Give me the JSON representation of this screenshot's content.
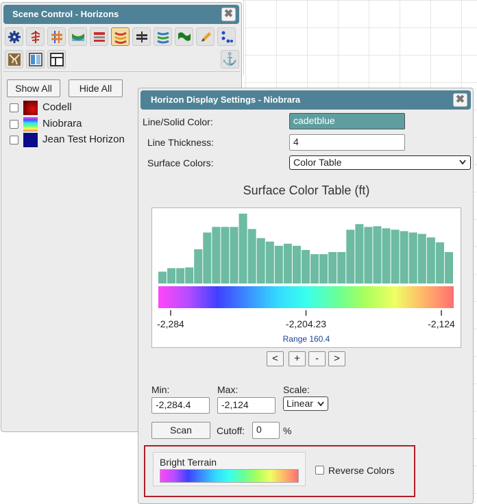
{
  "background": {
    "grid_color": "#e6e6e6"
  },
  "scene_control": {
    "title": "Scene Control - Horizons",
    "close_glyph": "✖",
    "toolbar_tools": [
      {
        "name": "settings-gear-icon",
        "color": "#1c3f8a"
      },
      {
        "name": "well-icon",
        "color": "#b3322b"
      },
      {
        "name": "faults-icon",
        "color": "#e07a2a"
      },
      {
        "name": "horizon-surface-icon",
        "color": "#3a8f2c"
      },
      {
        "name": "layers-red-icon",
        "color": "#c8302c"
      },
      {
        "name": "horizons-icon",
        "color": "#d03a2a",
        "active": true
      },
      {
        "name": "cross-section-icon",
        "color": "#333333"
      },
      {
        "name": "contours-icon",
        "color": "#2a7fc0"
      },
      {
        "name": "flag-green-icon",
        "color": "#1f7a1f"
      },
      {
        "name": "pencil-icon",
        "color": "#e8a020"
      },
      {
        "name": "points-icon",
        "color": "#1a4fd0"
      },
      {
        "name": "map-texture-icon",
        "color": "#8a6a3a"
      },
      {
        "name": "split-view-icon",
        "color": "#4a8fd0"
      },
      {
        "name": "layout-icon",
        "color": "#333333"
      }
    ],
    "anchor_icon": "⚓",
    "show_all_label": "Show All",
    "hide_all_label": "Hide All",
    "layers": [
      {
        "label": "Codell",
        "checked": false,
        "swatch": "codell"
      },
      {
        "label": "Niobrara",
        "checked": false,
        "swatch": "rainbow"
      },
      {
        "label": "Jean Test Horizon",
        "checked": false,
        "swatch": "navy"
      }
    ]
  },
  "horizon_dialog": {
    "title": "Horizon Display Settings - Niobrara",
    "close_glyph": "✖",
    "line_color_label": "Line/Solid Color:",
    "line_color_value": "cadetblue",
    "line_color_hex": "#5f9ea0",
    "line_thickness_label": "Line Thickness:",
    "line_thickness_value": "4",
    "surface_colors_label": "Surface Colors:",
    "surface_colors_value": "Color Table",
    "chart_title": "Surface Color Table (ft)",
    "range_label": "Range 160.4",
    "buttons": {
      "prev": "<",
      "plus": "+",
      "minus": "-",
      "next": ">"
    },
    "min_label": "Min:",
    "min_value": "-2,284.4",
    "max_label": "Max:",
    "max_value": "-2,124",
    "scale_label": "Scale:",
    "scale_value": "Linear",
    "scan_label": "Scan",
    "cutoff_label": "Cutoff:",
    "cutoff_value": "0",
    "cutoff_unit": "%",
    "preset_name": "Bright Terrain",
    "reverse_label": "Reverse Colors",
    "reverse_checked": false
  },
  "chart_data": {
    "type": "bar",
    "title": "Surface Color Table (ft)",
    "bar_color": "#6cbba2",
    "values": [
      17,
      22,
      22,
      23,
      49,
      73,
      81,
      81,
      81,
      100,
      78,
      65,
      60,
      54,
      57,
      54,
      48,
      42,
      42,
      45,
      45,
      77,
      85,
      81,
      82,
      79,
      77,
      75,
      73,
      71,
      66,
      59,
      45
    ],
    "ylim": [
      0,
      100
    ],
    "x_ticks": [
      "-2,284",
      "-2,204.23",
      "-2,124"
    ],
    "x_range": [
      -2284.4,
      -2124
    ],
    "colormap": [
      "#ff46f8",
      "#b74dff",
      "#4040ff",
      "#3c8cff",
      "#34d8ff",
      "#39ffef",
      "#66ff9c",
      "#a8ff5c",
      "#efff63",
      "#ffb46a",
      "#ff7070"
    ],
    "grid": false,
    "legend": "none"
  }
}
